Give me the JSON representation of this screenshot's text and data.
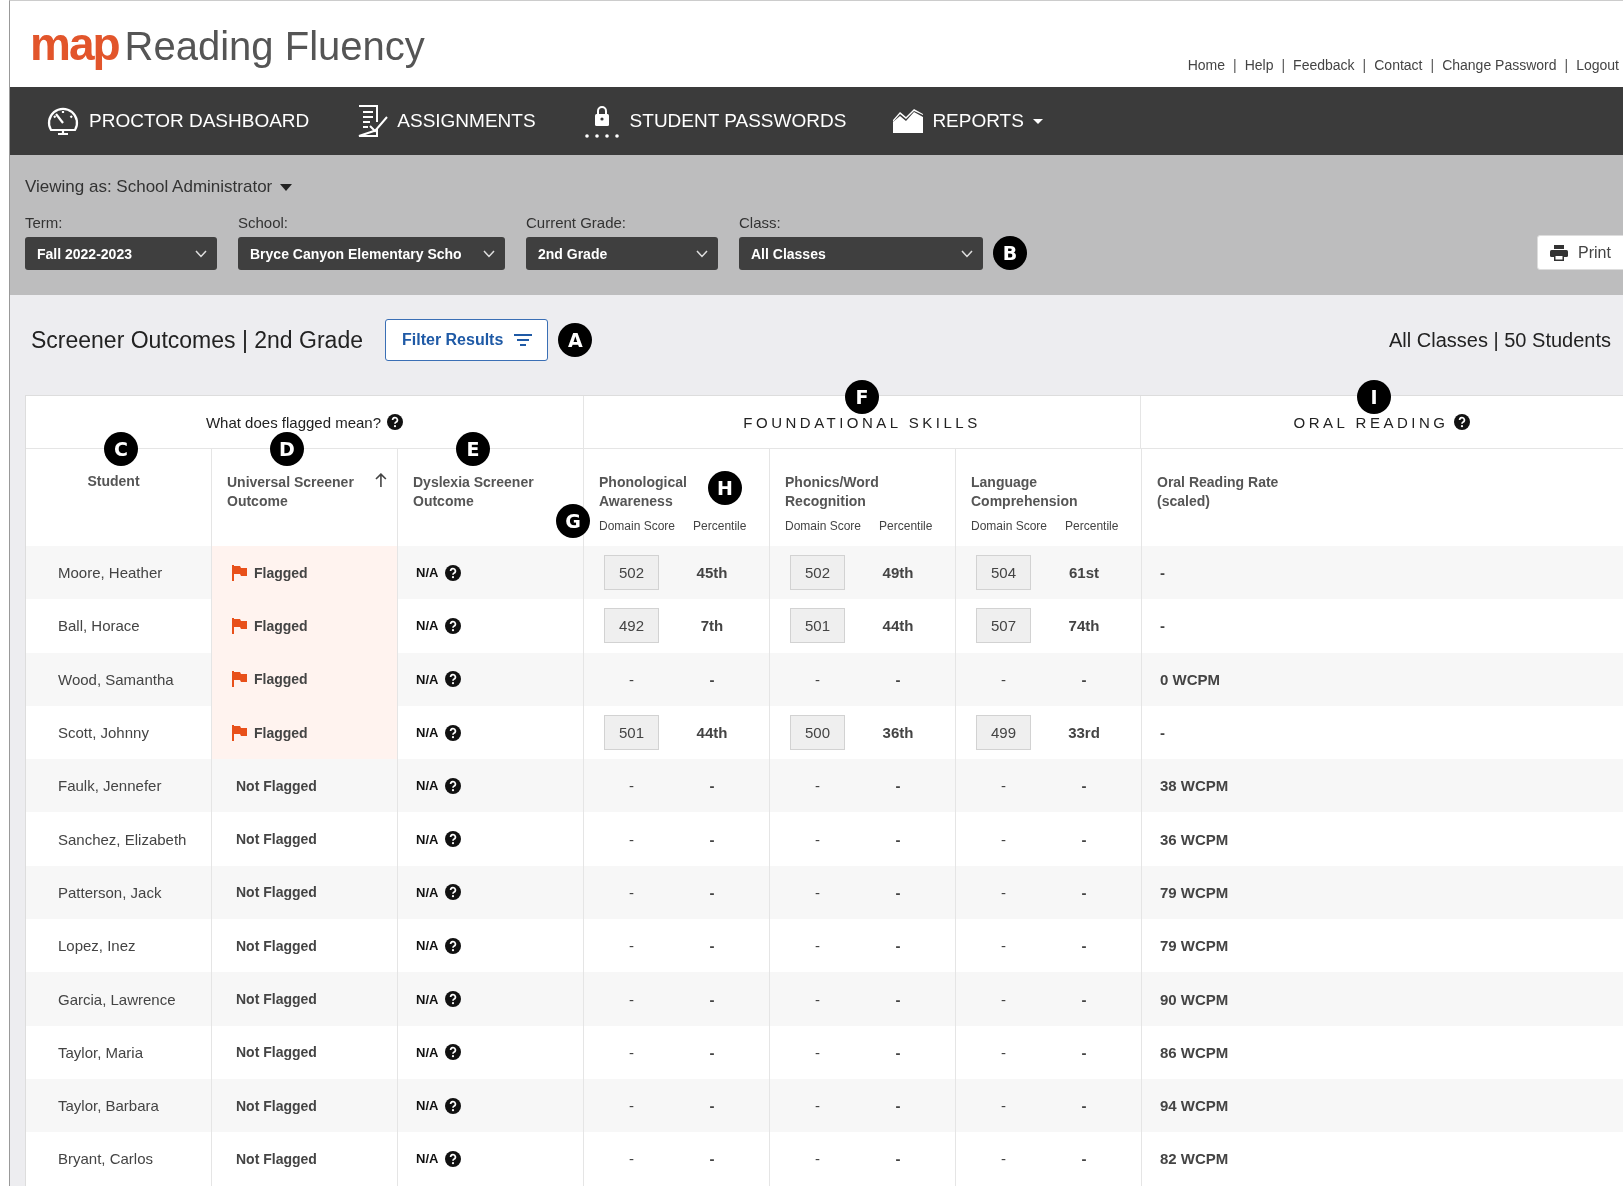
{
  "logo": {
    "brand": "map",
    "product": "Reading Fluency"
  },
  "top_links": [
    {
      "label": "Home"
    },
    {
      "separator": "|",
      "label": "Help"
    },
    {
      "separator": "|",
      "label": "Feedback"
    },
    {
      "separator": "|",
      "label": "Contact"
    },
    {
      "separator": "|",
      "label": "Change Password"
    },
    {
      "separator": "|",
      "label": "Logout"
    }
  ],
  "nav": [
    {
      "label": "PROCTOR DASHBOARD",
      "kind": "gauge"
    },
    {
      "label": "ASSIGNMENTS",
      "kind": "checklist"
    },
    {
      "label": "STUDENT PASSWORDS",
      "kind": "lock"
    },
    {
      "label": "REPORTS",
      "kind": "chart",
      "dropdown": true
    }
  ],
  "viewing_as": "Viewing as: School Administrator",
  "filters": [
    {
      "label": "Term:",
      "value": "Fall 2022-2023"
    },
    {
      "label": "School:",
      "value": "Bryce Canyon Elementary Scho"
    },
    {
      "label": "Current Grade:",
      "value": "2nd Grade"
    },
    {
      "label": "Class:",
      "value": "All Classes"
    }
  ],
  "print_button": "Print",
  "title": "Screener Outcomes | 2nd Grade",
  "filter_button": "Filter Results",
  "summary": "All Classes | 50 Students",
  "callouts": [
    "A",
    "B",
    "C",
    "D",
    "E",
    "F",
    "G",
    "H",
    "I"
  ],
  "group_headers": {
    "flag_help": "What does flagged mean?",
    "foundational": "FOUNDATIONAL SKILLS",
    "oral": "ORAL READING"
  },
  "columns": {
    "student": "Student",
    "universal": "Universal Screener Outcome",
    "dyslexia": "Dyslexia Screener Outcome",
    "domains": [
      {
        "name": "Phonological Awareness",
        "domain_score": "Domain Score",
        "percentile": "Percentile"
      },
      {
        "name": "Phonics/Word Recognition",
        "domain_score": "Domain Score",
        "percentile": "Percentile"
      },
      {
        "name": "Language Comprehension",
        "domain_score": "Domain Score",
        "percentile": "Percentile"
      }
    ],
    "oral": "Oral Reading Rate (scaled)"
  },
  "rows": [
    {
      "student": "Moore, Heather",
      "flagged": true,
      "outcome": "Flagged",
      "dyslexia": "N/A",
      "domains": [
        {
          "score": "502",
          "boxed": true,
          "percentile": "45th"
        },
        {
          "score": "502",
          "boxed": true,
          "percentile": "49th"
        },
        {
          "score": "504",
          "boxed": true,
          "percentile": "61st"
        }
      ],
      "oral": "-"
    },
    {
      "student": "Ball, Horace",
      "flagged": true,
      "outcome": "Flagged",
      "dyslexia": "N/A",
      "domains": [
        {
          "score": "492",
          "boxed": true,
          "percentile": "7th"
        },
        {
          "score": "501",
          "boxed": true,
          "percentile": "44th"
        },
        {
          "score": "507",
          "boxed": true,
          "percentile": "74th"
        }
      ],
      "oral": "-"
    },
    {
      "student": "Wood, Samantha",
      "flagged": true,
      "outcome": "Flagged",
      "dyslexia": "N/A",
      "domains": [
        {
          "score": "-",
          "boxed": false,
          "percentile": "-"
        },
        {
          "score": "-",
          "boxed": false,
          "percentile": "-"
        },
        {
          "score": "-",
          "boxed": false,
          "percentile": "-"
        }
      ],
      "oral": "0 WCPM"
    },
    {
      "student": "Scott, Johnny",
      "flagged": true,
      "outcome": "Flagged",
      "dyslexia": "N/A",
      "domains": [
        {
          "score": "501",
          "boxed": true,
          "percentile": "44th"
        },
        {
          "score": "500",
          "boxed": true,
          "percentile": "36th"
        },
        {
          "score": "499",
          "boxed": true,
          "percentile": "33rd"
        }
      ],
      "oral": "-"
    },
    {
      "student": "Faulk, Jennefer",
      "flagged": false,
      "outcome": "Not Flagged",
      "dyslexia": "N/A",
      "domains": [
        {
          "score": "-",
          "boxed": false,
          "percentile": "-"
        },
        {
          "score": "-",
          "boxed": false,
          "percentile": "-"
        },
        {
          "score": "-",
          "boxed": false,
          "percentile": "-"
        }
      ],
      "oral": "38 WCPM"
    },
    {
      "student": "Sanchez, Elizabeth",
      "flagged": false,
      "outcome": "Not Flagged",
      "dyslexia": "N/A",
      "domains": [
        {
          "score": "-",
          "boxed": false,
          "percentile": "-"
        },
        {
          "score": "-",
          "boxed": false,
          "percentile": "-"
        },
        {
          "score": "-",
          "boxed": false,
          "percentile": "-"
        }
      ],
      "oral": "36 WCPM"
    },
    {
      "student": "Patterson, Jack",
      "flagged": false,
      "outcome": "Not Flagged",
      "dyslexia": "N/A",
      "domains": [
        {
          "score": "-",
          "boxed": false,
          "percentile": "-"
        },
        {
          "score": "-",
          "boxed": false,
          "percentile": "-"
        },
        {
          "score": "-",
          "boxed": false,
          "percentile": "-"
        }
      ],
      "oral": "79 WCPM"
    },
    {
      "student": "Lopez, Inez",
      "flagged": false,
      "outcome": "Not Flagged",
      "dyslexia": "N/A",
      "domains": [
        {
          "score": "-",
          "boxed": false,
          "percentile": "-"
        },
        {
          "score": "-",
          "boxed": false,
          "percentile": "-"
        },
        {
          "score": "-",
          "boxed": false,
          "percentile": "-"
        }
      ],
      "oral": "79 WCPM"
    },
    {
      "student": "Garcia, Lawrence",
      "flagged": false,
      "outcome": "Not Flagged",
      "dyslexia": "N/A",
      "domains": [
        {
          "score": "-",
          "boxed": false,
          "percentile": "-"
        },
        {
          "score": "-",
          "boxed": false,
          "percentile": "-"
        },
        {
          "score": "-",
          "boxed": false,
          "percentile": "-"
        }
      ],
      "oral": "90 WCPM"
    },
    {
      "student": "Taylor, Maria",
      "flagged": false,
      "outcome": "Not Flagged",
      "dyslexia": "N/A",
      "domains": [
        {
          "score": "-",
          "boxed": false,
          "percentile": "-"
        },
        {
          "score": "-",
          "boxed": false,
          "percentile": "-"
        },
        {
          "score": "-",
          "boxed": false,
          "percentile": "-"
        }
      ],
      "oral": "86 WCPM"
    },
    {
      "student": "Taylor, Barbara",
      "flagged": false,
      "outcome": "Not Flagged",
      "dyslexia": "N/A",
      "domains": [
        {
          "score": "-",
          "boxed": false,
          "percentile": "-"
        },
        {
          "score": "-",
          "boxed": false,
          "percentile": "-"
        },
        {
          "score": "-",
          "boxed": false,
          "percentile": "-"
        }
      ],
      "oral": "94 WCPM"
    },
    {
      "student": "Bryant, Carlos",
      "flagged": false,
      "outcome": "Not Flagged",
      "dyslexia": "N/A",
      "domains": [
        {
          "score": "-",
          "boxed": false,
          "percentile": "-"
        },
        {
          "score": "-",
          "boxed": false,
          "percentile": "-"
        },
        {
          "score": "-",
          "boxed": false,
          "percentile": "-"
        }
      ],
      "oral": "82 WCPM"
    }
  ]
}
